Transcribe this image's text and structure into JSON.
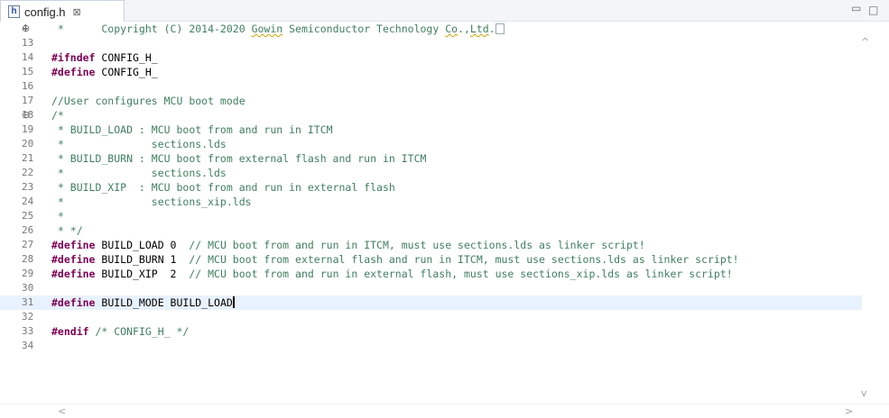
{
  "tab": {
    "icon_letter": "h",
    "title": "config.h",
    "close_glyph": "⊠"
  },
  "window": {
    "minimize_glyph": "▭",
    "maximize_glyph": "□"
  },
  "lines": [
    {
      "n": "4",
      "fold": "⊕",
      "html": "<span class=\"cm\"> *      Copyright (C) 2014-2020 <span class=\"squig\">Gowin</span> Semiconductor Technology <span class=\"squig\">Co</span>.,<span class=\"squig\">Ltd</span>.</span><span class=\"fold-box\"></span>"
    },
    {
      "n": "13",
      "html": ""
    },
    {
      "n": "14",
      "html": "<span class=\"kw\">#ifndef</span> CONFIG_H_"
    },
    {
      "n": "15",
      "html": "<span class=\"kw\">#define</span> CONFIG_H_"
    },
    {
      "n": "16",
      "html": ""
    },
    {
      "n": "17",
      "html": "<span class=\"cm\">//User configures MCU boot mode</span>"
    },
    {
      "n": "18",
      "fold": "⊖",
      "html": "<span class=\"cm\">/*</span>"
    },
    {
      "n": "19",
      "html": "<span class=\"cm\"> * BUILD_LOAD : MCU boot from and run in ITCM</span>"
    },
    {
      "n": "20",
      "html": "<span class=\"cm\"> *              sections.lds</span>"
    },
    {
      "n": "21",
      "html": "<span class=\"cm\"> * BUILD_BURN : MCU boot from external flash and run in ITCM</span>"
    },
    {
      "n": "22",
      "html": "<span class=\"cm\"> *              sections.lds</span>"
    },
    {
      "n": "23",
      "html": "<span class=\"cm\"> * BUILD_XIP  : MCU boot from and run in external flash</span>"
    },
    {
      "n": "24",
      "html": "<span class=\"cm\"> *              sections_xip.lds</span>"
    },
    {
      "n": "25",
      "html": "<span class=\"cm\"> *</span>"
    },
    {
      "n": "26",
      "html": "<span class=\"cm\"> * */</span>"
    },
    {
      "n": "27",
      "html": "<span class=\"kw\">#define</span> BUILD_LOAD 0  <span class=\"cm\">// MCU boot from and run in ITCM, must use sections.lds as linker script!</span>"
    },
    {
      "n": "28",
      "html": "<span class=\"kw\">#define</span> BUILD_BURN 1  <span class=\"cm\">// MCU boot from external flash and run in ITCM, must use sections.lds as linker script!</span>"
    },
    {
      "n": "29",
      "html": "<span class=\"kw\">#define</span> BUILD_XIP  2  <span class=\"cm\">// MCU boot from and run in external flash, must use sections_xip.lds as linker script!</span>"
    },
    {
      "n": "30",
      "html": ""
    },
    {
      "n": "31",
      "current": true,
      "html": "<span class=\"kw\">#define</span> BUILD_MODE BUILD_LOAD<span class=\"caret\"></span>"
    },
    {
      "n": "32",
      "html": ""
    },
    {
      "n": "33",
      "html": "<span class=\"kw\">#endif</span> <span class=\"cm\">/* CONFIG_H_ */</span>"
    },
    {
      "n": "34",
      "html": ""
    }
  ],
  "scroll": {
    "up": "^",
    "down": "v",
    "left": "<",
    "right": ">"
  }
}
